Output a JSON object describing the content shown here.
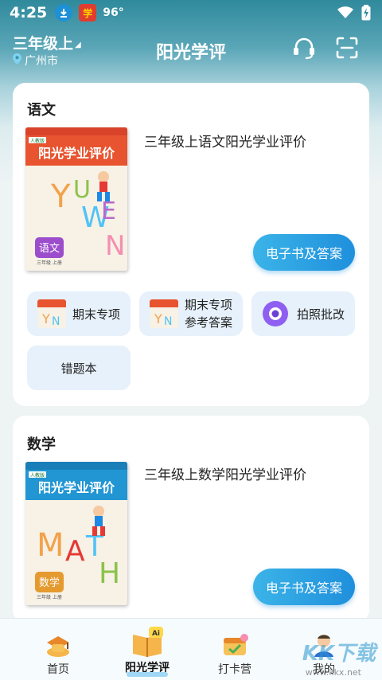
{
  "status": {
    "time": "4:25",
    "temp": "96°",
    "app_icon_text": "学"
  },
  "header": {
    "grade": "三年级上",
    "city": "广州市",
    "title": "阳光学评"
  },
  "subjects": [
    {
      "name": "语文",
      "book_title": "三年级上语文阳光学业评价",
      "ebook_label": "电子书及答案",
      "cover": {
        "series": "阳光学业评价",
        "big": "YUWEN",
        "badge": "语文",
        "badge_sub": "三年级 上册",
        "publisher": "人教版"
      },
      "tiles": [
        {
          "label": "期末专项"
        },
        {
          "label": "期末专项参考答案",
          "line1": "期末专项",
          "line2": "参考答案"
        },
        {
          "label": "拍照批改"
        },
        {
          "label": "错题本"
        }
      ]
    },
    {
      "name": "数学",
      "book_title": "三年级上数学阳光学业评价",
      "ebook_label": "电子书及答案",
      "cover": {
        "series": "阳光学业评价",
        "big": "MATH",
        "badge": "数学",
        "badge_sub": "三年级 上册",
        "publisher": "人教版"
      }
    }
  ],
  "nav": [
    {
      "label": "首页",
      "icon": "home-icon"
    },
    {
      "label": "阳光学评",
      "icon": "ai-book-icon",
      "active": true
    },
    {
      "label": "打卡营",
      "icon": "checkin-icon"
    },
    {
      "label": "我的",
      "icon": "profile-icon"
    }
  ],
  "watermark": {
    "text": "KK下载",
    "url": "www.kkx.net"
  },
  "colors": {
    "accent": "#1f8fdc",
    "tile_bg": "#e6f1fb",
    "header_top": "#2f8a9c"
  }
}
